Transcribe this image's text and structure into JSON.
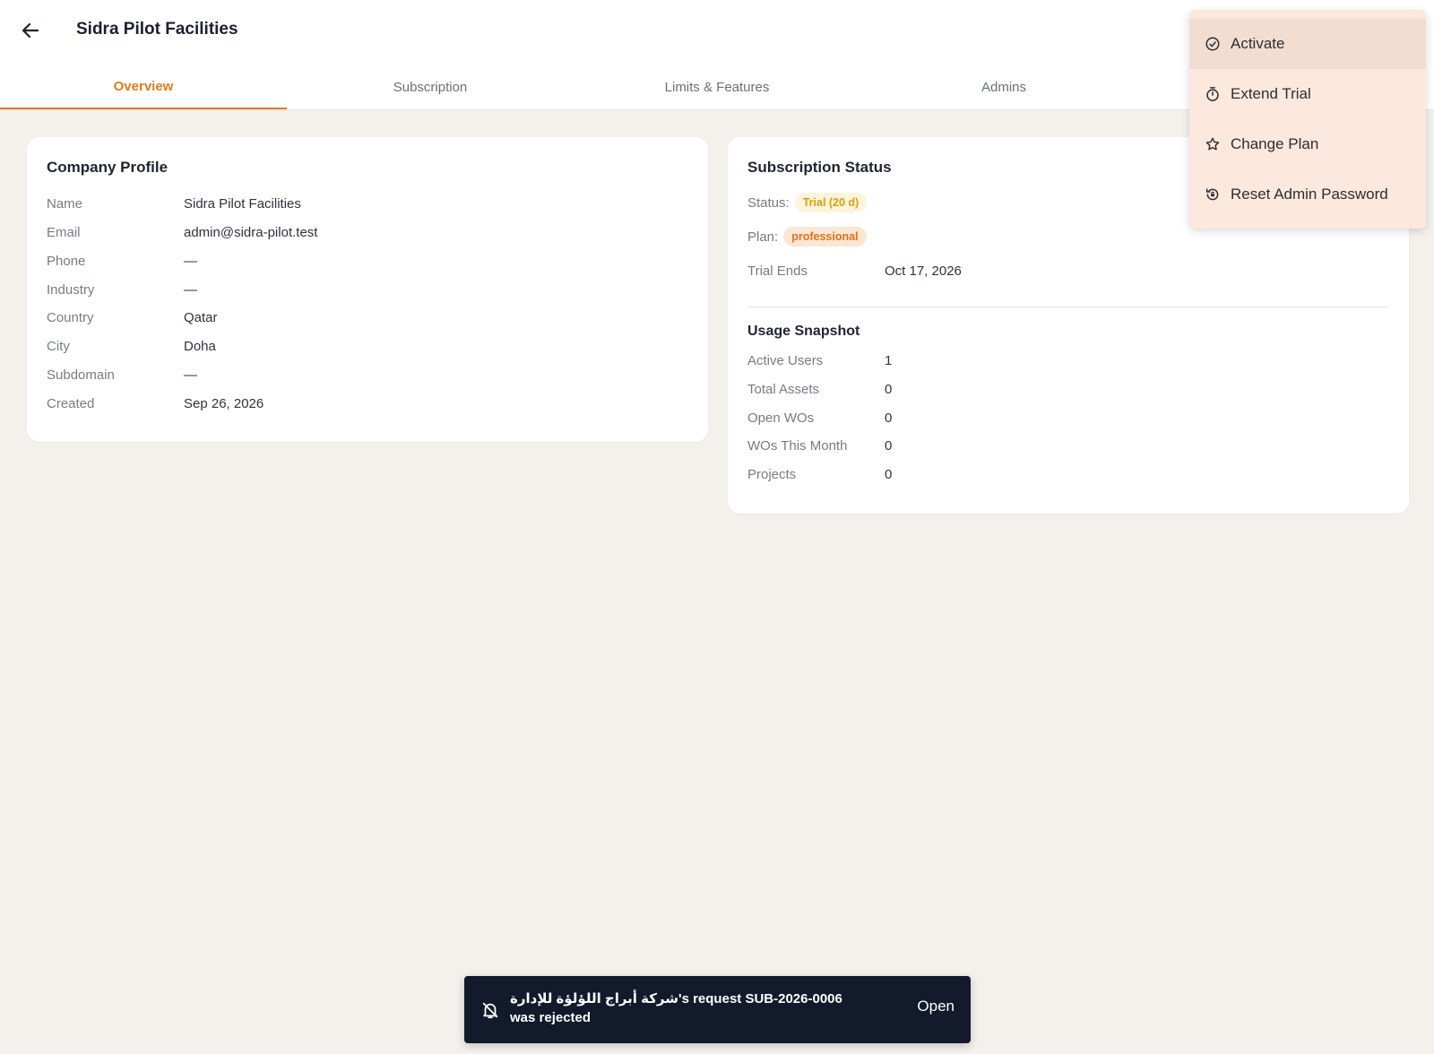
{
  "header": {
    "title": "Sidra Pilot Facilities"
  },
  "tabs": [
    {
      "label": "Overview",
      "active": true
    },
    {
      "label": "Subscription"
    },
    {
      "label": "Limits & Features"
    },
    {
      "label": "Admins"
    }
  ],
  "company_profile": {
    "title": "Company Profile",
    "rows": [
      {
        "label": "Name",
        "value": "Sidra Pilot Facilities"
      },
      {
        "label": "Email",
        "value": "admin@sidra-pilot.test"
      },
      {
        "label": "Phone",
        "value": "—"
      },
      {
        "label": "Industry",
        "value": "—"
      },
      {
        "label": "Country",
        "value": "Qatar"
      },
      {
        "label": "City",
        "value": "Doha"
      },
      {
        "label": "Subdomain",
        "value": "—"
      },
      {
        "label": "Created",
        "value": "Sep 26, 2026"
      }
    ]
  },
  "subscription_status": {
    "title": "Subscription Status",
    "status_label": "Status:",
    "status_value": "Trial (20 d)",
    "plan_label": "Plan:",
    "plan_value": "professional",
    "trial_ends_label": "Trial Ends",
    "trial_ends_value": "Oct 17, 2026",
    "usage_title": "Usage Snapshot",
    "usage": [
      {
        "label": "Active Users",
        "value": "1"
      },
      {
        "label": "Total Assets",
        "value": "0"
      },
      {
        "label": "Open WOs",
        "value": "0"
      },
      {
        "label": "WOs This Month",
        "value": "0"
      },
      {
        "label": "Projects",
        "value": "0"
      }
    ]
  },
  "menu": {
    "items": [
      {
        "label": "Activate",
        "icon": "check-circle-icon"
      },
      {
        "label": "Extend Trial",
        "icon": "timer-icon"
      },
      {
        "label": "Change Plan",
        "icon": "star-icon"
      },
      {
        "label": "Reset Admin Password",
        "icon": "lock-reset-icon"
      }
    ]
  },
  "toast": {
    "message": "شركة أبراج اللؤلؤة للإدارة's request SUB-2026-0006 was rejected",
    "action": "Open"
  },
  "colors": {
    "accent": "#e07b1c",
    "trial_badge_bg": "#fdf4dc",
    "trial_badge_text": "#d8a112",
    "plan_badge_bg": "#fde6d3",
    "plan_badge_text": "#d9741a",
    "toast_bg": "#121a2c"
  }
}
